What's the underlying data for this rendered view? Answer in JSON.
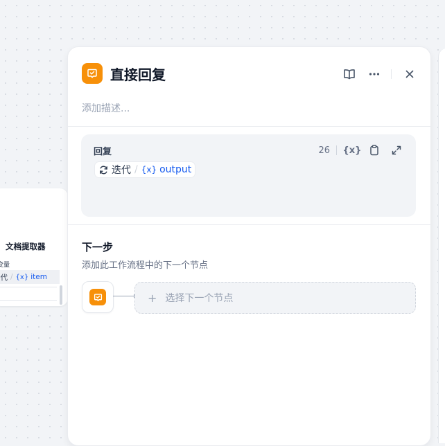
{
  "background_node": {
    "title": "文档提取器",
    "sub_label": "变量",
    "var_parent": "迭代",
    "var_name": "item"
  },
  "panel": {
    "title": "直接回复",
    "description_placeholder": "添加描述...",
    "icon": "reply-icon",
    "accent_color": "#f79009",
    "header_actions": [
      "book-icon",
      "more-icon",
      "close-icon"
    ]
  },
  "reply": {
    "label": "回复",
    "char_count": "26",
    "tools": [
      "variable-icon",
      "copy-icon",
      "expand-icon"
    ],
    "variable": {
      "parent": "迭代",
      "name": "output"
    }
  },
  "next_step": {
    "title": "下一步",
    "description": "添加此工作流程中的下一个节点",
    "select_label": "选择下一个节点"
  }
}
